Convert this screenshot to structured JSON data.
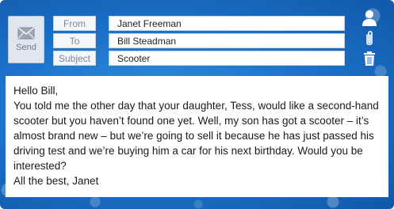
{
  "send": {
    "label": "Send",
    "icon": "envelope-icon"
  },
  "fields": {
    "from_label": "From",
    "from_value": "Janet Freeman",
    "to_label": "To",
    "to_value": "Bill Steadman",
    "subject_label": "Subject",
    "subject_value": "Scooter"
  },
  "side_icons": [
    "contact-icon",
    "attachment-icon",
    "trash-icon"
  ],
  "message": {
    "greeting": "Hello Bill,",
    "body": "You told me the other day that your daughter, Tess, would like a second-hand scooter but you haven’t found one yet. Well, my son has got a scooter – it’s almost brand new – but we’re going to sell it because he has just passed his driving test and we’re buying him a car for his next birthday. Would you be interested?",
    "signoff": "All the best, Janet"
  },
  "colors": {
    "background": "#1a6fc6",
    "accent_icon": "#ffffff",
    "label_text": "#7c8896"
  }
}
